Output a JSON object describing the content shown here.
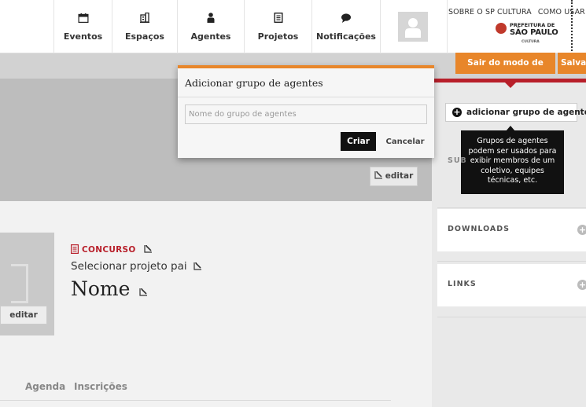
{
  "header": {
    "nav": [
      {
        "label": "Eventos",
        "icon": "calendar-icon"
      },
      {
        "label": "Espaços",
        "icon": "building-icon"
      },
      {
        "label": "Agentes",
        "icon": "person-icon"
      },
      {
        "label": "Projetos",
        "icon": "document-icon"
      },
      {
        "label": "Notificações",
        "icon": "speech-bubble-icon"
      }
    ],
    "top_links": [
      "SOBRE O SP CULTURA",
      "COMO USAR"
    ],
    "logo": {
      "line1": "PREFEITURA DE",
      "line2": "SÃO PAULO",
      "line3": "CULTURA"
    }
  },
  "toolbar": {
    "exit_edit_label": "Sair do modo de edição",
    "save_label": "Salvar"
  },
  "banner": {
    "edit_label": "editar"
  },
  "project": {
    "thumb_edit_label": "editar",
    "type_label": "CONCURSO",
    "parent_label": "Selecionar projeto pai",
    "name_label": "Nome"
  },
  "tabs": [
    {
      "label": "Agenda"
    },
    {
      "label": "Inscrições"
    }
  ],
  "sidebar": {
    "add_group_label": "adicionar grupo de agentes",
    "tooltip": "Grupos de agentes podem ser usados para exibir membros de um coletivo, equipes técnicas, etc.",
    "sub_label": "SUB",
    "downloads_title": "DOWNLOADS",
    "links_title": "LINKS"
  },
  "modal": {
    "title": "Adicionar grupo de agentes",
    "input_value": "",
    "input_placeholder": "Nome do grupo de agentes",
    "create_label": "Criar",
    "cancel_label": "Cancelar"
  },
  "colors": {
    "accent_orange": "#e8862a",
    "brand_red": "#b81f2a"
  }
}
